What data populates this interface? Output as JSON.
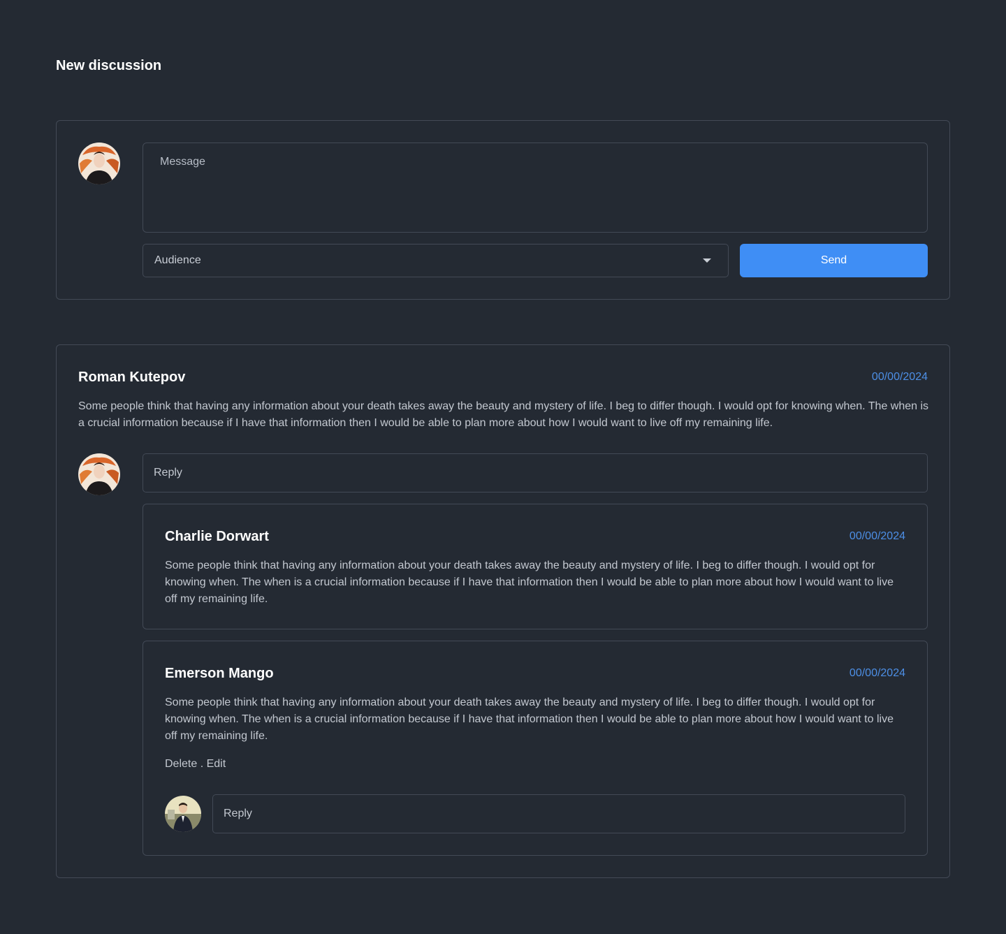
{
  "page": {
    "title": "New discussion"
  },
  "compose": {
    "message_placeholder": "Message",
    "audience_label": "Audience",
    "send_label": "Send"
  },
  "thread": {
    "author": "Roman Kutepov",
    "date": "00/00/2024",
    "body": "Some people think that having any information about your death takes away the beauty and mystery of life. I beg to differ though. I would opt for knowing when. The when is a crucial information because if I have that information then I would be able to plan more about how I would want to live off my remaining life.",
    "reply_placeholder": "Reply",
    "replies": [
      {
        "author": "Charlie Dorwart",
        "date": "00/00/2024",
        "body": "Some people think that having any information about your death takes away the beauty and mystery of life. I beg to differ though. I would opt for knowing when. The when is a crucial information because if I have that information then I would be able to plan more about how I would want to live off my remaining life."
      },
      {
        "author": "Emerson Mango",
        "date": "00/00/2024",
        "body": "Some people think that having any information about your death takes away the beauty and mystery of life. I beg to differ though. I would opt for knowing when. The when is a crucial information because if I have that information then I would be able to plan more about how I would want to live off my remaining life.",
        "delete_label": "Delete",
        "separator": " . ",
        "edit_label": "Edit",
        "reply_placeholder": "Reply"
      }
    ]
  },
  "colors": {
    "background": "#242a33",
    "border": "#434a56",
    "accent": "#3f8ef5",
    "date": "#4d8fe6"
  },
  "icons": {
    "audience_caret": "caret-down-icon"
  }
}
